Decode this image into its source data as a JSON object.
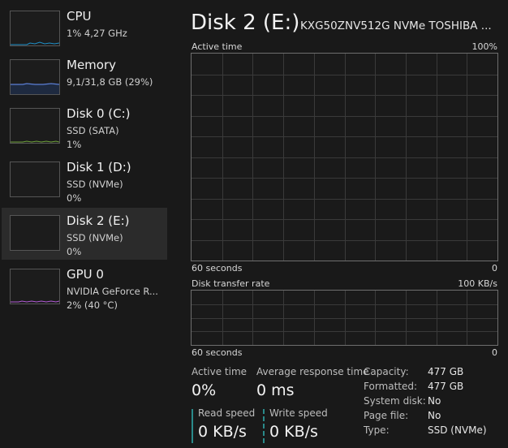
{
  "sidebar": {
    "items": [
      {
        "name": "CPU",
        "line1": "1% 4,27 GHz",
        "line2": "",
        "graph_color": "#1e90c8"
      },
      {
        "name": "Memory",
        "line1": "9,1/31,8 GB (29%)",
        "line2": "",
        "graph_color": "#5b7fd6"
      },
      {
        "name": "Disk 0 (C:)",
        "line1": "SSD (SATA)",
        "line2": "1%",
        "graph_color": "#6ea13a"
      },
      {
        "name": "Disk 1 (D:)",
        "line1": "SSD (NVMe)",
        "line2": "0%",
        "graph_color": "#6ea13a"
      },
      {
        "name": "Disk 2 (E:)",
        "line1": "SSD (NVMe)",
        "line2": "0%",
        "graph_color": "#6ea13a",
        "selected": true
      },
      {
        "name": "GPU 0",
        "line1": "NVIDIA GeForce R...",
        "line2": "2% (40 °C)",
        "graph_color": "#b25bd6"
      }
    ]
  },
  "header": {
    "title": "Disk 2 (E:)",
    "model": "KXG50ZNV512G NVMe TOSHIBA ..."
  },
  "graphs": {
    "active_time": {
      "label": "Active time",
      "max_label": "100%",
      "time_label": "60 seconds",
      "min_label": "0"
    },
    "transfer_rate": {
      "label": "Disk transfer rate",
      "max_label": "100 KB/s",
      "time_label": "60 seconds",
      "min_label": "0"
    }
  },
  "stats": {
    "active_time": {
      "label": "Active time",
      "value": "0%"
    },
    "avg_response": {
      "label": "Average response time",
      "value": "0 ms"
    },
    "read_speed": {
      "label": "Read speed",
      "value": "0 KB/s"
    },
    "write_speed": {
      "label": "Write speed",
      "value": "0 KB/s"
    }
  },
  "properties": [
    {
      "key": "Capacity:",
      "value": "477 GB"
    },
    {
      "key": "Formatted:",
      "value": "477 GB"
    },
    {
      "key": "System disk:",
      "value": "No"
    },
    {
      "key": "Page file:",
      "value": "No"
    },
    {
      "key": "Type:",
      "value": "SSD (NVMe)"
    }
  ],
  "colors": {
    "grid": "#3a3a3a",
    "accent_teal": "#2a8a8a",
    "selected_bg": "#2b2b2b"
  }
}
